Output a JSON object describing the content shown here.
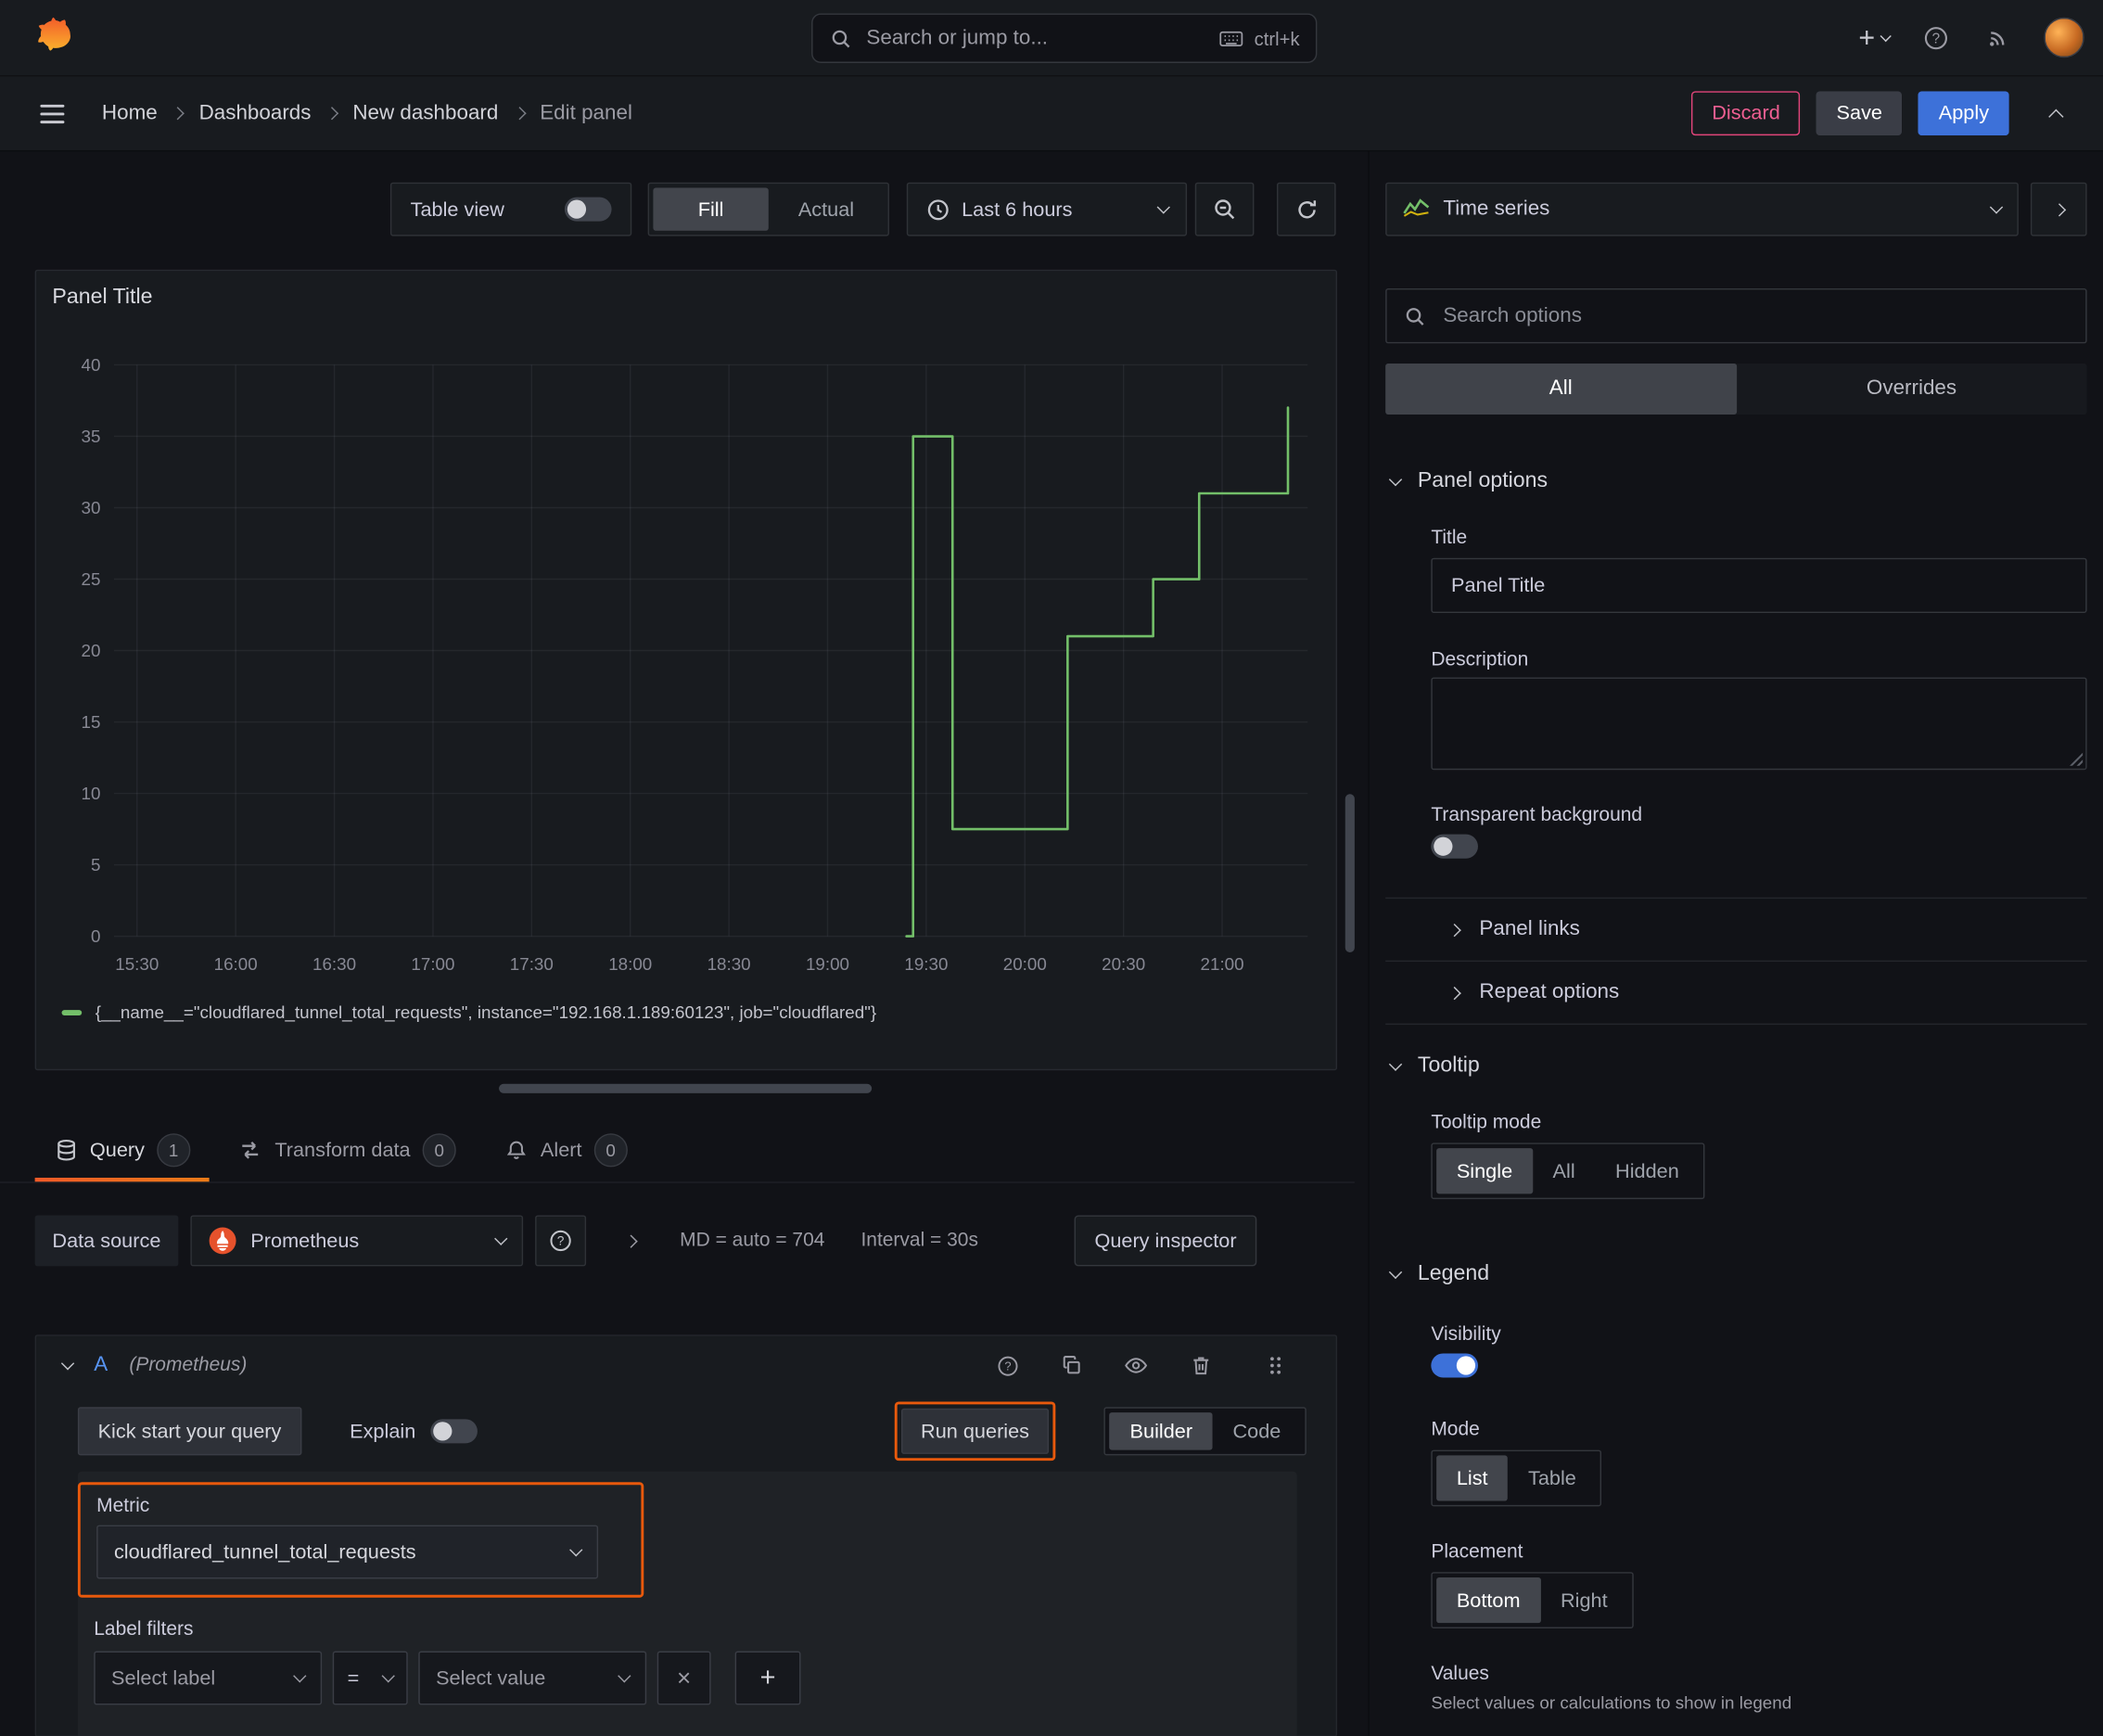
{
  "colors": {
    "accent_orange": "#e8590c",
    "tab_underline_orange": "#f05a28",
    "series_green": "#73bf69",
    "primary_blue": "#3d71d9",
    "ref_id_blue": "#5794f2",
    "destructive_red": "#e0457a"
  },
  "topnav": {
    "search": {
      "placeholder": "Search or jump to...",
      "shortcut": "ctrl+k"
    }
  },
  "breadcrumb": {
    "items": [
      "Home",
      "Dashboards",
      "New dashboard",
      "Edit panel"
    ]
  },
  "header_actions": {
    "discard": "Discard",
    "save": "Save",
    "apply": "Apply"
  },
  "toolbar": {
    "table_view": "Table view",
    "fill": "Fill",
    "actual": "Actual",
    "time_range": "Last 6 hours"
  },
  "panel": {
    "title": "Panel Title",
    "legend_label": "{__name__=\"cloudflared_tunnel_total_requests\", instance=\"192.168.1.189:60123\", job=\"cloudflared\"}"
  },
  "chart_data": {
    "type": "line",
    "title": "Panel Title",
    "line_color": "#73bf69",
    "grid": true,
    "legend_position": "bottom",
    "ylim": [
      0,
      40
    ],
    "yticks": [
      0,
      5,
      10,
      15,
      20,
      25,
      30,
      35,
      40
    ],
    "xticks": [
      "15:30",
      "16:00",
      "16:30",
      "17:00",
      "17:30",
      "18:00",
      "18:30",
      "19:00",
      "19:30",
      "20:00",
      "20:30",
      "21:00"
    ],
    "x_domain": [
      "15:23",
      "21:26"
    ],
    "series": [
      {
        "name": "{__name__=\"cloudflared_tunnel_total_requests\", instance=\"192.168.1.189:60123\", job=\"cloudflared\"}",
        "step": true,
        "points": [
          [
            "19:24",
            0
          ],
          [
            "19:26",
            0
          ],
          [
            "19:26",
            35
          ],
          [
            "19:38",
            35
          ],
          [
            "19:38",
            7.5
          ],
          [
            "20:13",
            7.5
          ],
          [
            "20:13",
            21
          ],
          [
            "20:39",
            21
          ],
          [
            "20:39",
            25
          ],
          [
            "20:53",
            25
          ],
          [
            "20:53",
            31
          ],
          [
            "21:20",
            31
          ],
          [
            "21:20",
            37
          ]
        ]
      }
    ]
  },
  "editor_tabs": {
    "query": {
      "label": "Query",
      "count": "1"
    },
    "transform": {
      "label": "Transform data",
      "count": "0"
    },
    "alert": {
      "label": "Alert",
      "count": "0"
    }
  },
  "datasource_row": {
    "label": "Data source",
    "name": "Prometheus",
    "max_data_points": "MD = auto = 704",
    "interval": "Interval = 30s",
    "query_inspector": "Query inspector"
  },
  "query": {
    "ref_id": "A",
    "datasource_hint": "(Prometheus)",
    "kick_start": "Kick start your query",
    "explain": "Explain",
    "run_queries": "Run queries",
    "builder": "Builder",
    "code": "Code",
    "metric_label": "Metric",
    "metric_value": "cloudflared_tunnel_total_requests",
    "label_filters_label": "Label filters",
    "select_label": "Select label",
    "operator": "=",
    "select_value": "Select value"
  },
  "sidebar": {
    "viz_picker": "Time series",
    "search_placeholder": "Search options",
    "tabs": {
      "all": "All",
      "overrides": "Overrides"
    },
    "panel_options": {
      "header": "Panel options",
      "title_label": "Title",
      "title_value": "Panel Title",
      "description_label": "Description",
      "transparent_label": "Transparent background",
      "panel_links": "Panel links",
      "repeat_options": "Repeat options"
    },
    "tooltip": {
      "header": "Tooltip",
      "mode_label": "Tooltip mode",
      "options": {
        "single": "Single",
        "all": "All",
        "hidden": "Hidden"
      }
    },
    "legend": {
      "header": "Legend",
      "visibility_label": "Visibility",
      "mode_label": "Mode",
      "mode_options": {
        "list": "List",
        "table": "Table"
      },
      "placement_label": "Placement",
      "placement_options": {
        "bottom": "Bottom",
        "right": "Right"
      },
      "values_label": "Values",
      "values_hint": "Select values or calculations to show in legend"
    }
  }
}
